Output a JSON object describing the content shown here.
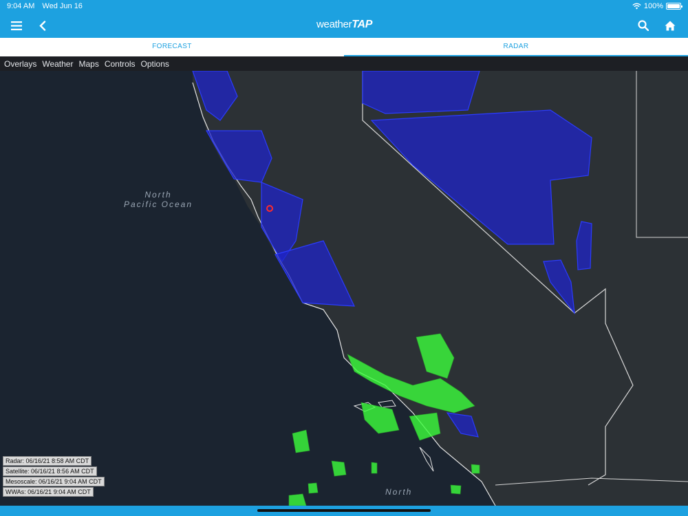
{
  "status": {
    "time": "9:04 AM",
    "date": "Wed Jun 16",
    "battery": "100%"
  },
  "appbar": {
    "logo_left": "weather",
    "logo_right": "TAP",
    "menu_icon": "hamburger-menu-icon",
    "back_icon": "chevron-left-icon",
    "search_icon": "search-icon",
    "home_icon": "home-icon"
  },
  "tabs": [
    {
      "label": "FORECAST",
      "active": false
    },
    {
      "label": "RADAR",
      "active": true
    }
  ],
  "menu": [
    "Overlays",
    "Weather",
    "Maps",
    "Controls",
    "Options"
  ],
  "map": {
    "ocean_label_line1": "North",
    "ocean_label_line2": "Pacific Ocean",
    "ocean_label_bottom": "North"
  },
  "legend": [
    "Radar: 06/16/21 8:58 AM CDT",
    "Satellite: 06/16/21 8:56 AM CDT",
    "Mesoscale: 06/16/21 9:04 AM CDT",
    "WWAs: 06/16/21 9:04 AM CDT"
  ],
  "colors": {
    "accent": "#1da1e0",
    "warning_fill": "#1f24c8",
    "radar_green": "#3cff3c"
  }
}
